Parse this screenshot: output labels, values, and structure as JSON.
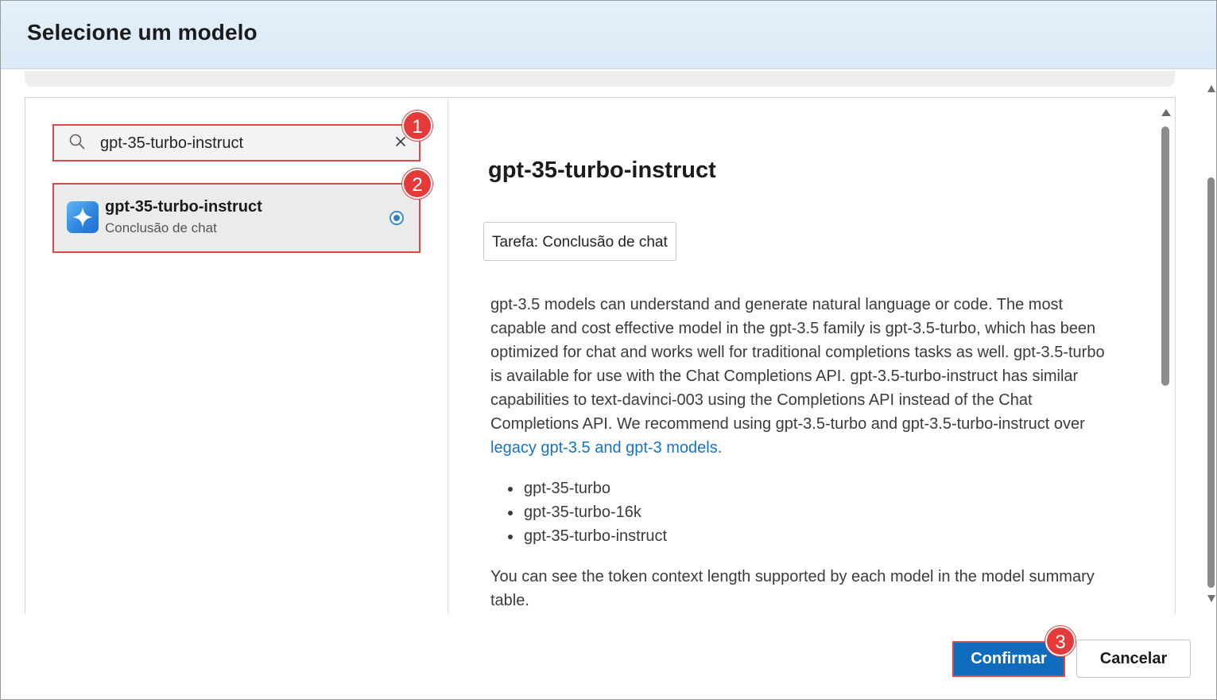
{
  "dialog": {
    "title": "Selecione um modelo"
  },
  "search": {
    "value": "gpt-35-turbo-instruct",
    "search_icon": "search-icon",
    "clear_icon": "close-icon"
  },
  "model_list": [
    {
      "name": "gpt-35-turbo-instruct",
      "subtitle": "Conclusão de chat",
      "icon": "sparkle-icon",
      "selected": true
    }
  ],
  "detail": {
    "title": "gpt-35-turbo-instruct",
    "task_chip": "Tarefa: Conclusão de chat",
    "description": "gpt-3.5 models can understand and generate natural language or code. The most capable and cost effective model in the gpt-3.5 family is gpt-3.5-turbo, which has been optimized for chat and works well for traditional completions tasks as well. gpt-3.5-turbo is available for use with the Chat Completions API. gpt-3.5-turbo-instruct has similar capabilities to text-davinci-003 using the Completions API instead of the Chat Completions API. We recommend using gpt-3.5-turbo and gpt-3.5-turbo-instruct over",
    "link_text": "legacy gpt-3.5 and gpt-3 models.",
    "bullets": [
      "gpt-35-turbo",
      "gpt-35-turbo-16k",
      "gpt-35-turbo-instruct"
    ],
    "footer_text": "You can see the token context length supported by each model in the model summary table."
  },
  "annotations": {
    "badge_1": "1",
    "badge_2": "2",
    "badge_3": "3",
    "badge_color": "#e53a3a"
  },
  "buttons": {
    "confirm_label": "Confirmar",
    "cancel_label": "Cancelar"
  },
  "colors": {
    "accent": "#0f6cbd",
    "link": "#1473c6",
    "highlight_border": "#e04848",
    "header_bg": "#dbeaf7"
  }
}
